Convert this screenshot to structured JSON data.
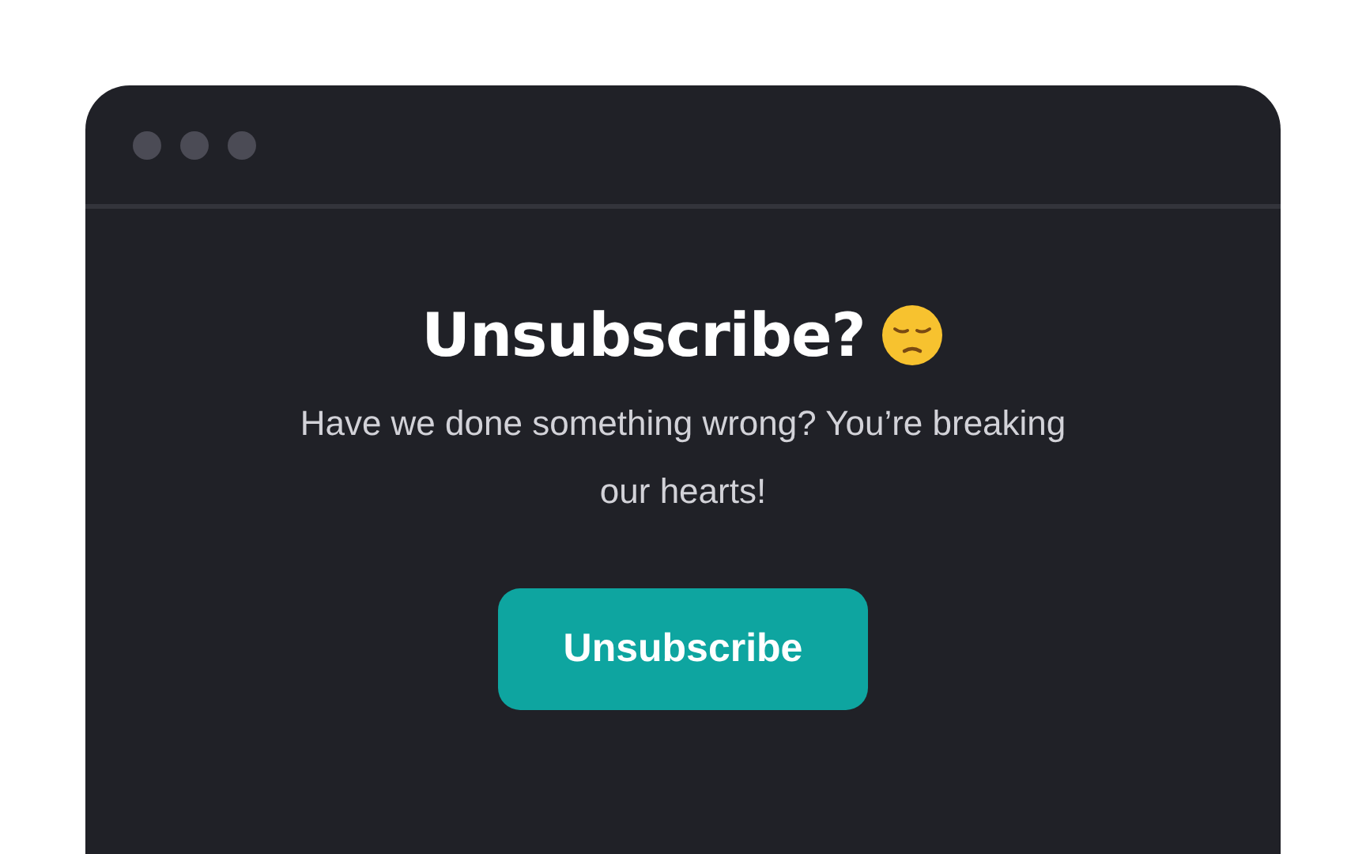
{
  "heading": "Unsubscribe?",
  "message": "Have we done something wrong? You’re breaking our hearts!",
  "button": {
    "label": "Unsubscribe"
  }
}
